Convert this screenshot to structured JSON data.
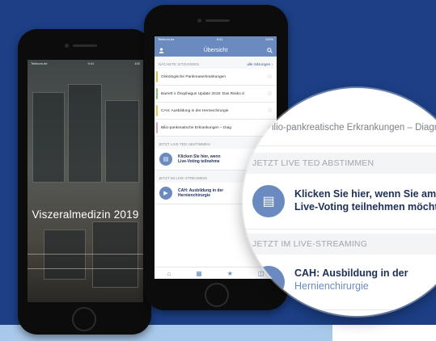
{
  "left_phone": {
    "status_carrier": "Telekom.de",
    "status_time": "9:41",
    "status_battery": "100",
    "title": "Viszeralmedizin 2019"
  },
  "right_phone": {
    "status_carrier": "Telekom.de",
    "status_time": "9:41",
    "status_battery": "100%",
    "header_title": "Übersicht",
    "section_next": "NÄCHSTE SITZUNGEN",
    "section_next_link": "alle Sitzungen ›",
    "sessions": [
      {
        "title": "Onkologische Pankreaserkrankungen",
        "color": "#d9c24a"
      },
      {
        "title": "Barrett´s Ösophagus Update 2018: Das Risiko d",
        "color": "#8dc07a"
      },
      {
        "title": "CAH: Ausbildung in der Herniechirurgie",
        "color": "#e0c84e"
      },
      {
        "title": "Bilio-pankreatische Erkrankungen – Diag",
        "color": "#d7a4b4"
      }
    ],
    "section_ted": "JETZT LIVE TED ABSTIMMEN",
    "ted_card": {
      "line1": "Klicken Sie hier, wenn",
      "line2": "Live-Voting teilnehme"
    },
    "section_stream": "JETZT IM LIVE-STREAMING",
    "stream_card": {
      "line1": "CAH: Ausbildung in der",
      "line2": "Hernienchirurgie"
    },
    "tabbar_icons": [
      "home-icon",
      "calendar-icon",
      "star-icon",
      "map-icon"
    ]
  },
  "magnifier": {
    "faded_top": "...",
    "session_text": "ilio-pankreatische Erkrankungen – Diagnos",
    "section_ted": "JETZT LIVE TED ABSTIMMEN",
    "ted_line1": "Klicken Sie hier, wenn Sie am \"ED",
    "ted_line2": "Live-Voting teilnehmen möchten.",
    "section_stream": "JETZT IM LIVE-STREAMING",
    "stream_line1": "CAH: Ausbildung in der",
    "stream_line2": "Hernienchirurgie"
  }
}
